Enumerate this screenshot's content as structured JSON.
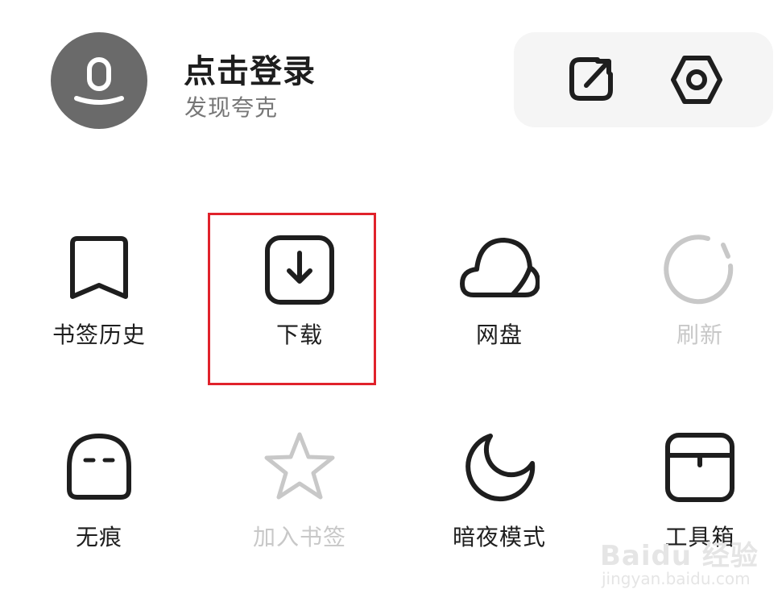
{
  "profile": {
    "title": "点击登录",
    "subtitle": "发现夸克",
    "avatar_icon": "user-icon"
  },
  "header_actions": [
    {
      "name": "share-icon"
    },
    {
      "name": "settings-icon"
    }
  ],
  "grid": [
    {
      "label": "书签历史",
      "icon": "bookmark-icon",
      "enabled": true
    },
    {
      "label": "下载",
      "icon": "download-icon",
      "enabled": true,
      "highlighted": true
    },
    {
      "label": "网盘",
      "icon": "cloud-icon",
      "enabled": true
    },
    {
      "label": "刷新",
      "icon": "refresh-icon",
      "enabled": false
    },
    {
      "label": "无痕",
      "icon": "incognito-icon",
      "enabled": true
    },
    {
      "label": "加入书签",
      "icon": "star-icon",
      "enabled": false
    },
    {
      "label": "暗夜模式",
      "icon": "moon-icon",
      "enabled": true
    },
    {
      "label": "工具箱",
      "icon": "toolbox-icon",
      "enabled": true
    }
  ],
  "colors": {
    "icon": "#1e1e1e",
    "disabled": "#c8c8c8",
    "avatar_bg": "#6a6a6a",
    "panel_bg": "#f5f5f5",
    "highlight": "#e0222b"
  },
  "watermark": {
    "main": "Baidu 经验",
    "sub": "jingyan.baidu.com"
  }
}
